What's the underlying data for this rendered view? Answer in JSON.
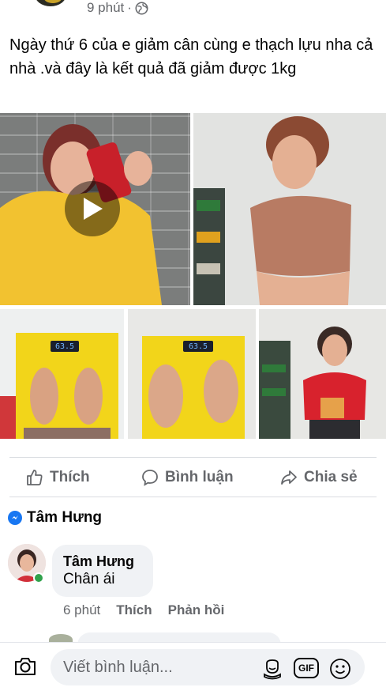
{
  "header": {
    "time": "9 phút",
    "separator": "·"
  },
  "post": {
    "text": "Ngày thứ 6 của e giảm cân cùng e thạch lựu nha cả nhà .và đây là kết quả đã giảm được 1kg"
  },
  "scale_readings": [
    "63.5",
    "63.5"
  ],
  "actions": {
    "like": "Thích",
    "comment": "Bình luận",
    "share": "Chia sẻ"
  },
  "top_commenter": "Tâm Hưng",
  "comment": {
    "author": "Tâm Hưng",
    "text": "Chân ái",
    "time": "6 phút",
    "like": "Thích",
    "reply": "Phản hồi"
  },
  "composer": {
    "placeholder": "Viết bình luận...",
    "gif": "GIF"
  },
  "colors": {
    "facebook_blue": "#1877f2",
    "muted_text": "#65676b",
    "online_green": "#31a24c",
    "bubble_bg": "#f0f2f5"
  }
}
